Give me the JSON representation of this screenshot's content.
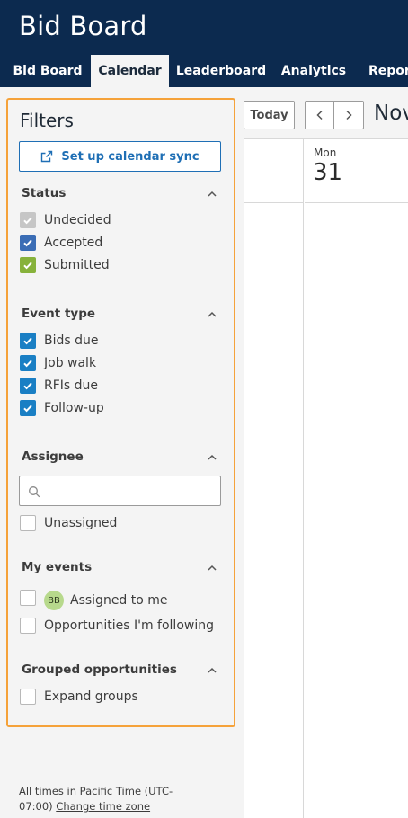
{
  "app": {
    "title": "Bid Board"
  },
  "tabs": [
    {
      "label": "Bid Board",
      "active": false
    },
    {
      "label": "Calendar",
      "active": true
    },
    {
      "label": "Leaderboard",
      "active": false
    },
    {
      "label": "Analytics",
      "active": false
    },
    {
      "label": "Report",
      "active": false
    }
  ],
  "filters": {
    "title": "Filters",
    "sync_label": "Set up calendar sync",
    "status": {
      "heading": "Status",
      "items": [
        {
          "label": "Undecided",
          "checked": true,
          "color": "#c6c6c6"
        },
        {
          "label": "Accepted",
          "checked": true,
          "color": "#3b6db5"
        },
        {
          "label": "Submitted",
          "checked": true,
          "color": "#87b23b"
        }
      ]
    },
    "event_type": {
      "heading": "Event type",
      "items": [
        {
          "label": "Bids due",
          "checked": true
        },
        {
          "label": "Job walk",
          "checked": true
        },
        {
          "label": "RFIs due",
          "checked": true
        },
        {
          "label": "Follow-up",
          "checked": true
        }
      ],
      "color": "#1a7fc4"
    },
    "assignee": {
      "heading": "Assignee",
      "search_value": "",
      "unassigned_label": "Unassigned"
    },
    "my_events": {
      "heading": "My events",
      "assigned_label": "Assigned to me",
      "avatar_initials": "BB",
      "following_label": "Opportunities I'm following"
    },
    "grouped": {
      "heading": "Grouped opportunities",
      "expand_label": "Expand groups"
    }
  },
  "timezone": {
    "note": "All times in Pacific Time (UTC-07:00)",
    "link": "Change time zone"
  },
  "calendar": {
    "today_label": "Today",
    "month_label": "Nov",
    "day_name": "Mon",
    "day_number": "31"
  }
}
